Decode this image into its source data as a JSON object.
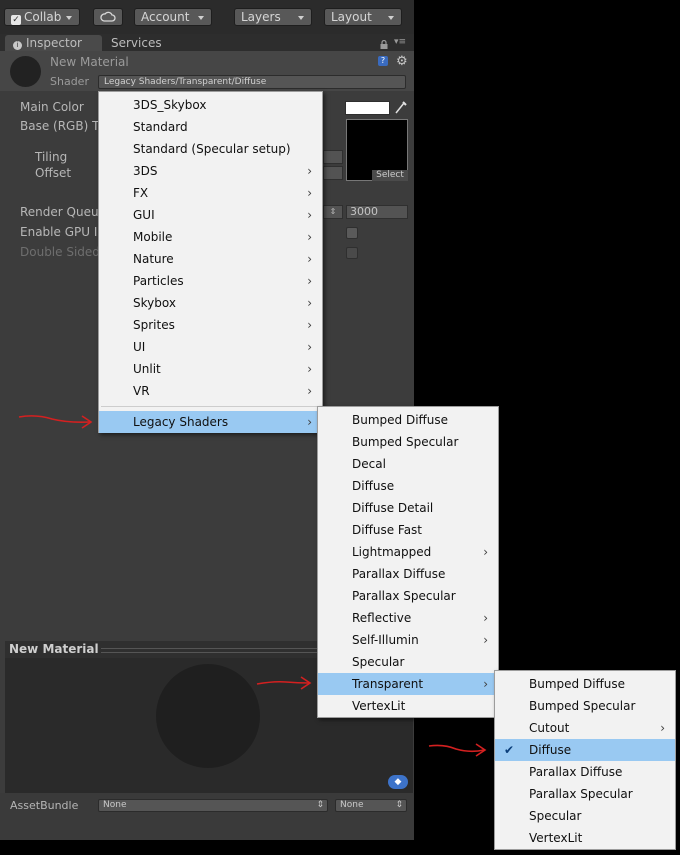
{
  "toolbar": {
    "collab": "Collab",
    "account": "Account",
    "layers": "Layers",
    "layout": "Layout"
  },
  "tabs": {
    "inspector": "Inspector",
    "services": "Services"
  },
  "material": {
    "name": "New Material",
    "shader_label": "Shader",
    "shader_value": "Legacy Shaders/Transparent/Diffuse"
  },
  "props": {
    "main_color": "Main Color",
    "base": "Base (RGB) T",
    "tiling": "Tiling",
    "offset": "Offset",
    "render_queue": "Render Queue",
    "render_queue_value": "3000",
    "gpu": "Enable GPU In",
    "double_sided": "Double Sided",
    "select": "Select"
  },
  "preview": {
    "title": "New Material"
  },
  "assetbundle": {
    "label": "AssetBundle",
    "value1": "None",
    "value2": "None"
  },
  "menu1": [
    {
      "label": "3DS_Skybox",
      "sub": false
    },
    {
      "label": "Standard",
      "sub": false
    },
    {
      "label": "Standard (Specular setup)",
      "sub": false
    },
    {
      "label": "3DS",
      "sub": true
    },
    {
      "label": "FX",
      "sub": true
    },
    {
      "label": "GUI",
      "sub": true
    },
    {
      "label": "Mobile",
      "sub": true
    },
    {
      "label": "Nature",
      "sub": true
    },
    {
      "label": "Particles",
      "sub": true
    },
    {
      "label": "Skybox",
      "sub": true
    },
    {
      "label": "Sprites",
      "sub": true
    },
    {
      "label": "UI",
      "sub": true
    },
    {
      "label": "Unlit",
      "sub": true
    },
    {
      "label": "VR",
      "sub": true
    },
    {
      "label": "Legacy Shaders",
      "sub": true,
      "highlight": true
    }
  ],
  "menu2": [
    {
      "label": "Bumped Diffuse",
      "sub": false
    },
    {
      "label": "Bumped Specular",
      "sub": false
    },
    {
      "label": "Decal",
      "sub": false
    },
    {
      "label": "Diffuse",
      "sub": false
    },
    {
      "label": "Diffuse Detail",
      "sub": false
    },
    {
      "label": "Diffuse Fast",
      "sub": false
    },
    {
      "label": "Lightmapped",
      "sub": true
    },
    {
      "label": "Parallax Diffuse",
      "sub": false
    },
    {
      "label": "Parallax Specular",
      "sub": false
    },
    {
      "label": "Reflective",
      "sub": true
    },
    {
      "label": "Self-Illumin",
      "sub": true
    },
    {
      "label": "Specular",
      "sub": false
    },
    {
      "label": "Transparent",
      "sub": true,
      "highlight": true
    },
    {
      "label": "VertexLit",
      "sub": false
    }
  ],
  "menu3": [
    {
      "label": "Bumped Diffuse",
      "sub": false
    },
    {
      "label": "Bumped Specular",
      "sub": false
    },
    {
      "label": "Cutout",
      "sub": true
    },
    {
      "label": "Diffuse",
      "sub": false,
      "highlight": true,
      "checked": true
    },
    {
      "label": "Parallax Diffuse",
      "sub": false
    },
    {
      "label": "Parallax Specular",
      "sub": false
    },
    {
      "label": "Specular",
      "sub": false
    },
    {
      "label": "VertexLit",
      "sub": false
    }
  ],
  "colors": {
    "highlight": "#99c9f2",
    "arrow": "#d42020",
    "panel": "#3c3c3c"
  }
}
